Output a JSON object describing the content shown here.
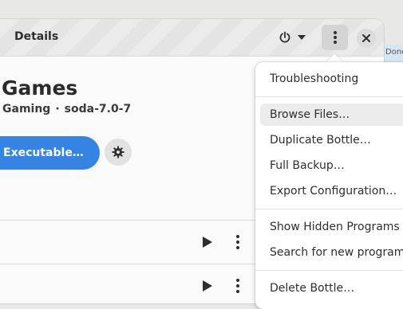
{
  "background_window": {
    "button_text": "Done"
  },
  "header": {
    "title": "Details"
  },
  "bottle": {
    "name": "Games",
    "environment": "Gaming",
    "separator": "·",
    "runner": "soda-7.0-7",
    "run_button_label": "Executable…"
  },
  "menu": {
    "items": [
      {
        "label": "Troubleshooting"
      },
      {
        "label": "Browse Files…"
      },
      {
        "label": "Duplicate Bottle…"
      },
      {
        "label": "Full Backup…"
      },
      {
        "label": "Export Configuration…"
      },
      {
        "label": "Show Hidden Programs"
      },
      {
        "label": "Search for new programs"
      },
      {
        "label": "Delete Bottle…"
      }
    ]
  },
  "colors": {
    "accent": "#3584e4",
    "window_bg": "#fafafa",
    "header_bg": "#ebebeb"
  },
  "icons": [
    "power-icon",
    "chevron-down-icon",
    "kebab-icon",
    "close-icon",
    "gear-icon",
    "play-icon"
  ]
}
